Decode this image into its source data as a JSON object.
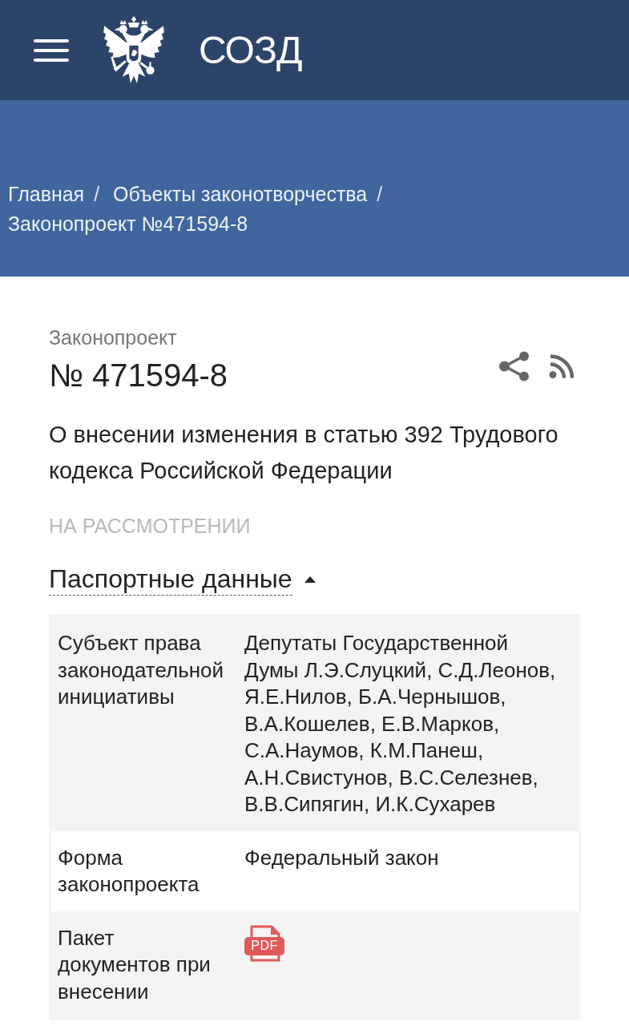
{
  "header": {
    "title": "СОЗД"
  },
  "breadcrumbs": [
    {
      "label": "Главная",
      "separator": "/"
    },
    {
      "label": "Объекты законотворчества",
      "separator": "/"
    },
    {
      "label": "Законопроект №471594-8"
    }
  ],
  "bill": {
    "type_label": "Законопроект",
    "number": "№ 471594-8",
    "title": "О внесении изменения в статью 392 Трудового кодекса Российской Федерации",
    "status": "НА РАССМОТРЕНИИ"
  },
  "passport": {
    "title": "Паспортные данные",
    "expanded": true,
    "rows": [
      {
        "label": "Субъект права законодательной инициативы",
        "kind": "text",
        "value": "Депутаты Государственной Думы Л.Э.Слуцкий, С.Д.Леонов, Я.Е.Нилов, Б.А.Чернышов, В.А.Кошелев, Е.В.Марков, С.А.Наумов, К.М.Панеш, А.Н.Свистунов, В.С.Селезнев, В.В.Сипягин, И.К.Сухарев"
      },
      {
        "label": "Форма законопроекта",
        "kind": "text",
        "value": "Федеральный закон"
      },
      {
        "label": "Пакет документов при внесении",
        "kind": "file",
        "file_label": "PDF"
      }
    ]
  }
}
